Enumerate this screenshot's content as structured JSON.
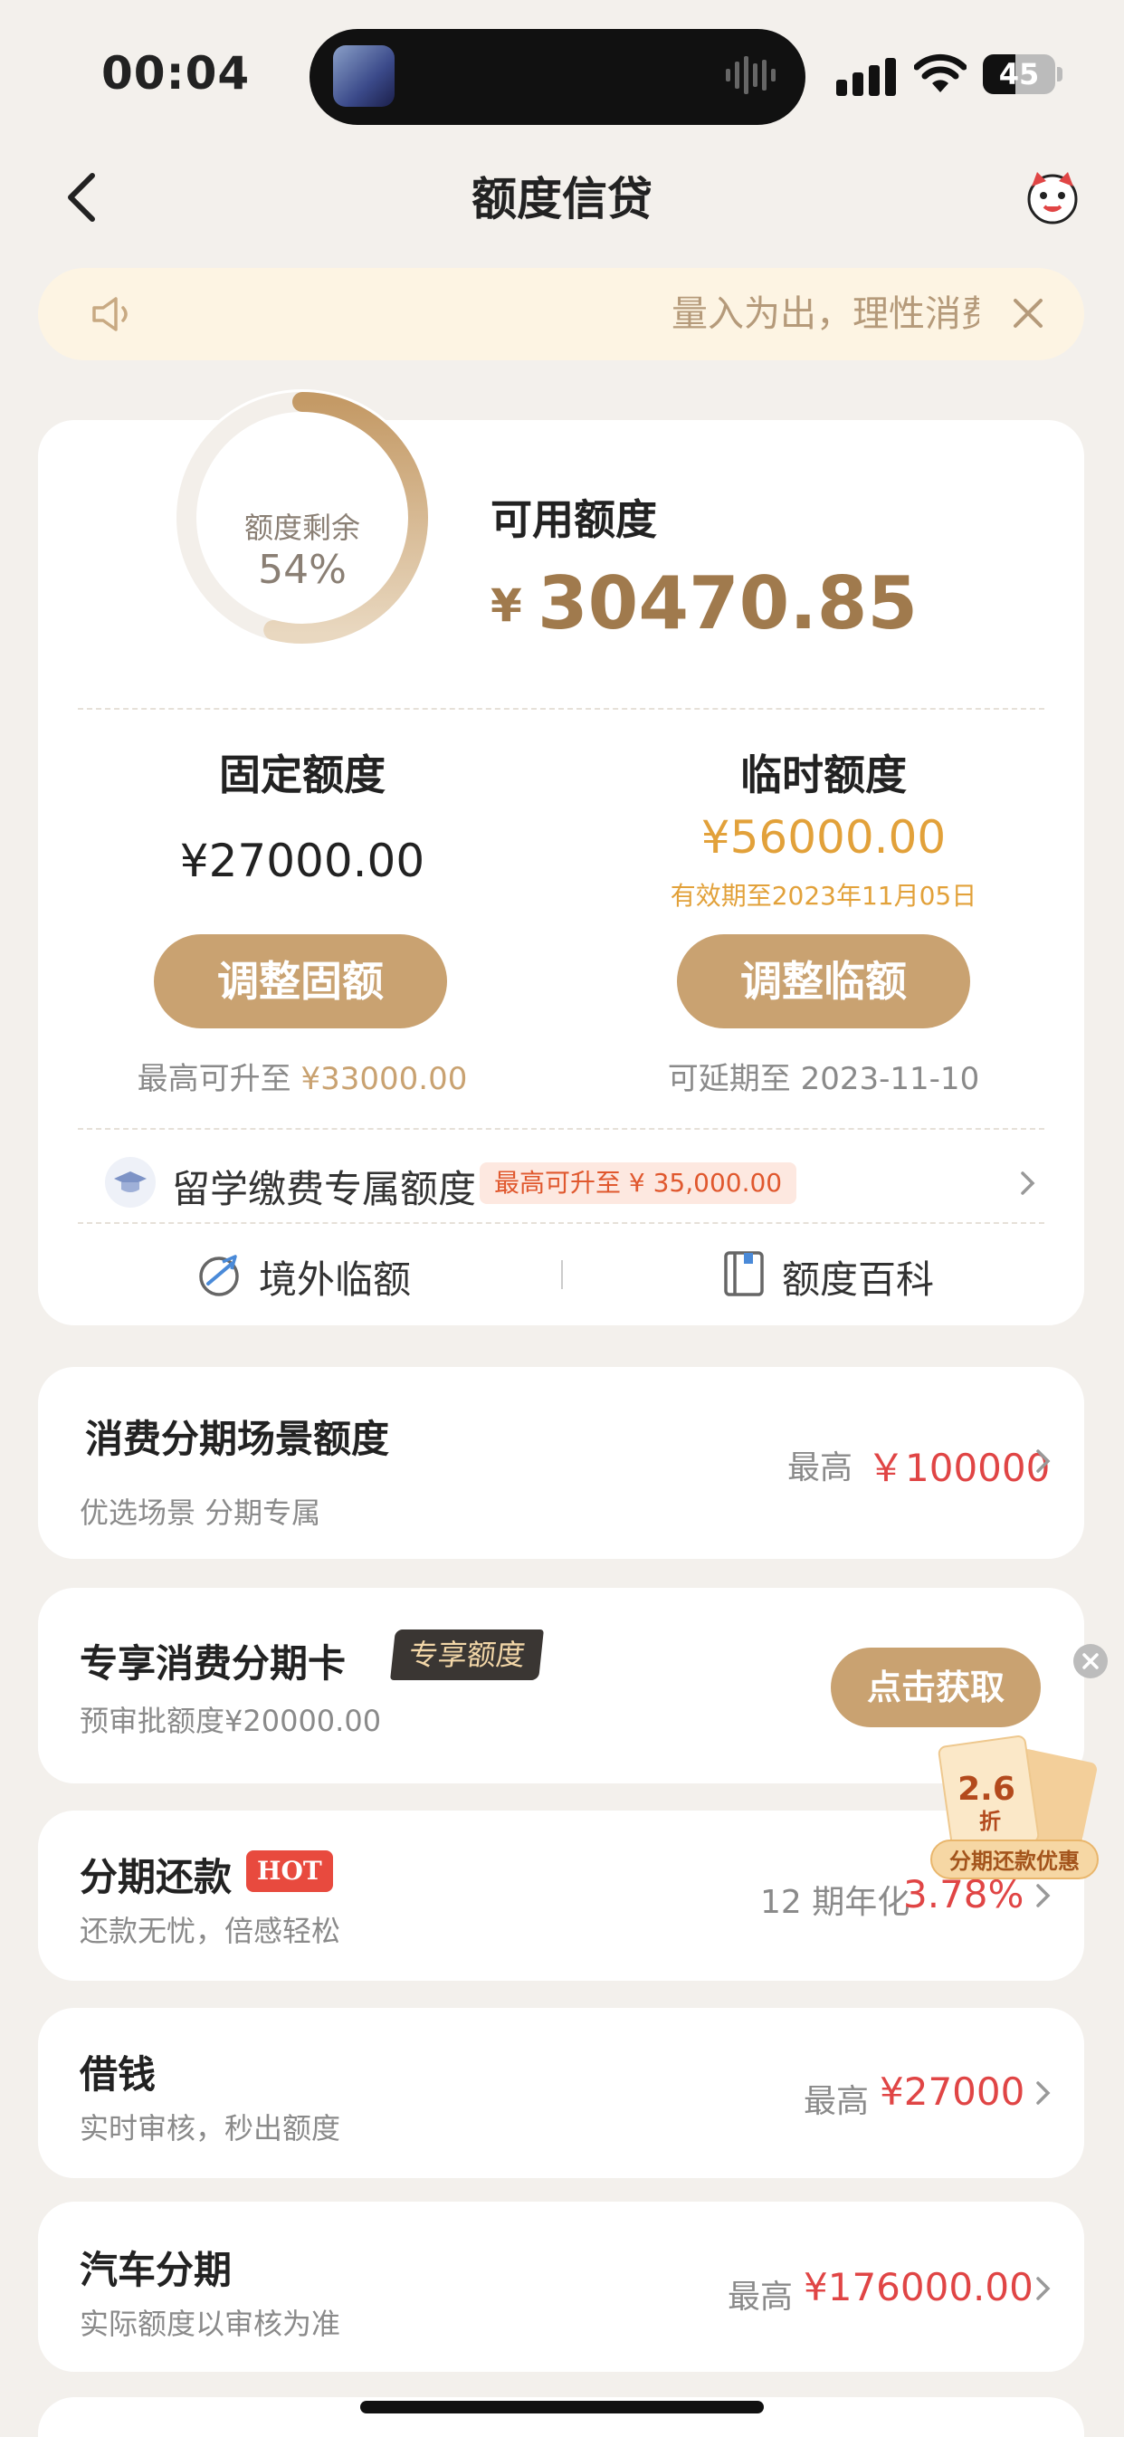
{
  "status_bar": {
    "time": "00:04",
    "battery": "45",
    "battery_level_pct": 45
  },
  "nav": {
    "title": "额度信贷"
  },
  "notice": {
    "text": "量入为出，理性消费"
  },
  "credit": {
    "ring_label": "额度剩余",
    "ring_pct_text": "54%",
    "ring_fraction": 0.54,
    "available_label": "可用额度",
    "currency": "¥",
    "available_value": "30470.85",
    "fixed_label": "固定额度",
    "fixed_value": "¥27000.00",
    "fixed_btn": "调整固额",
    "fixed_up_prefix": "最高可升至",
    "fixed_up_value": "¥33000.00",
    "temp_label": "临时额度",
    "temp_value": "¥56000.00",
    "temp_valid": "有效期至2023年11月05日",
    "temp_btn": "调整临额",
    "temp_extend": "可延期至 2023-11-10",
    "study_label": "留学缴费专属额度",
    "study_tag": "最高可升至 ¥ 35,000.00",
    "abroad_label": "境外临额",
    "wiki_label": "额度百科"
  },
  "rows": {
    "scene": {
      "title": "消费分期场景额度",
      "sub": "优选场景 分期专属",
      "pre": "最高",
      "value": "￥100000"
    },
    "card": {
      "title": "专享消费分期卡",
      "tag": "专享额度",
      "sub": "预审批额度¥20000.00",
      "btn": "点击获取"
    },
    "repay": {
      "title": "分期还款",
      "hot": "HOT",
      "sub": "还款无忧，倍感轻松",
      "pre": "12 期年化",
      "value": "3.78%"
    },
    "borrow": {
      "title": "借钱",
      "sub": "实时审核，秒出额度",
      "pre": "最高",
      "value": "¥27000"
    },
    "car": {
      "title": "汽车分期",
      "sub": "实际额度以审核为准",
      "pre": "最高",
      "value": "¥176000.00"
    }
  },
  "promo": {
    "discount": "2.6",
    "discount_unit": "折",
    "label": "分期还款优惠"
  },
  "colors": {
    "gold": "#c9a271",
    "amount_gold": "#a07a4d",
    "orange": "#e2a13a",
    "red": "#e04545",
    "background": "#f3f0ec"
  }
}
